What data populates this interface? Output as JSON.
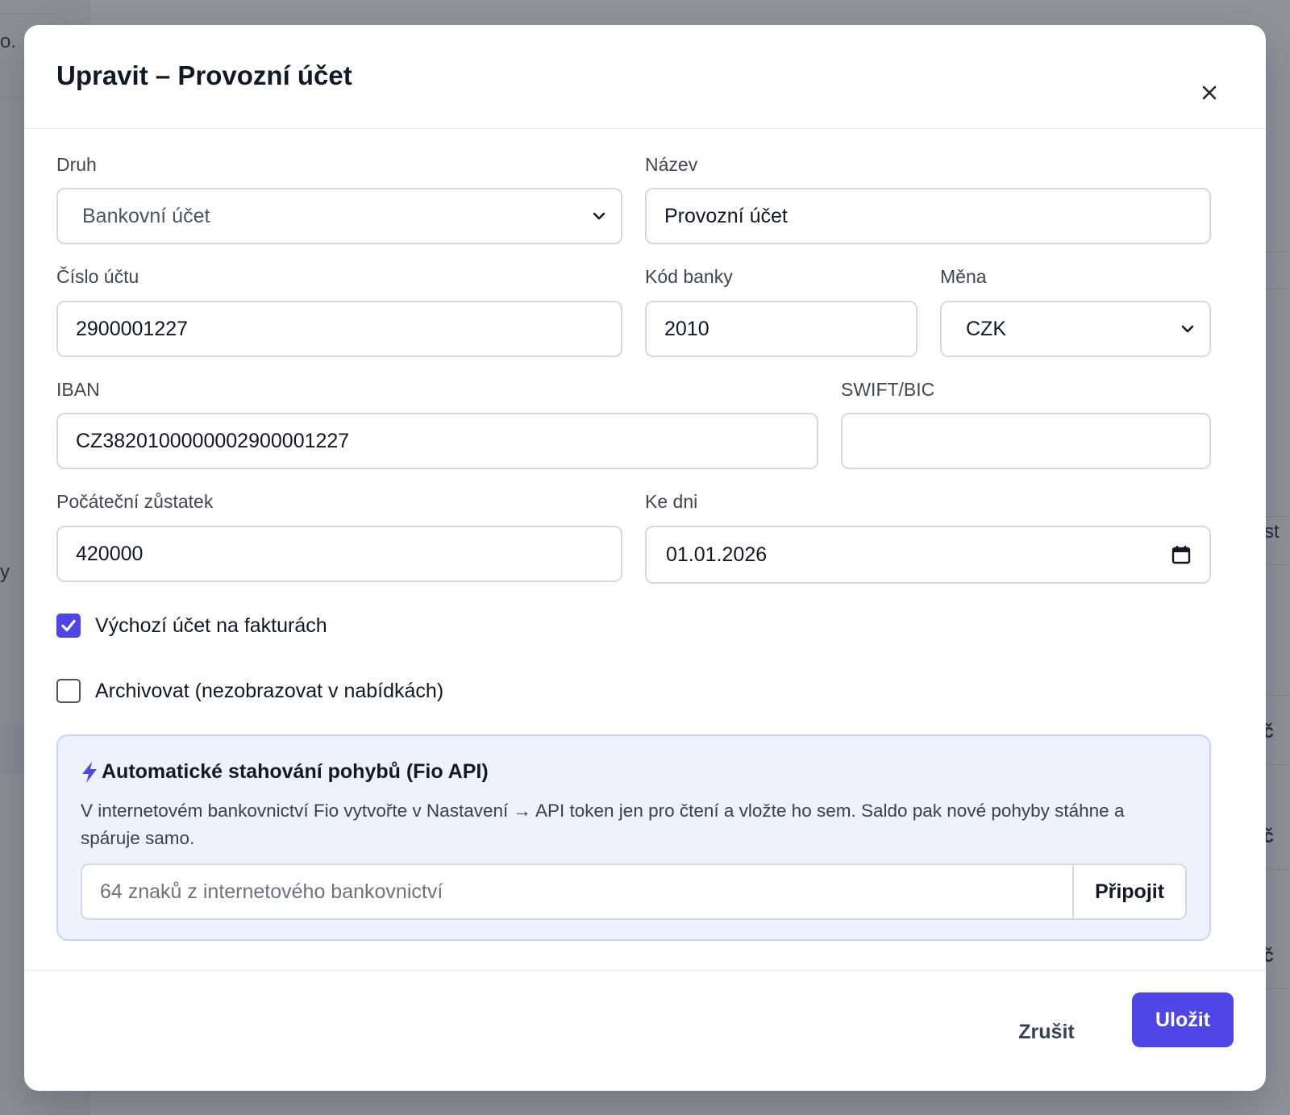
{
  "background": {
    "fragments": [
      "o.",
      "y",
      "tist",
      "úč",
      "úč",
      "úč"
    ]
  },
  "modal": {
    "title": "Upravit – Provozní účet",
    "close_label": "×"
  },
  "form": {
    "druh": {
      "label": "Druh",
      "value": "Bankovní účet"
    },
    "nazev": {
      "label": "Název",
      "value": "Provozní účet"
    },
    "cislo_uctu": {
      "label": "Číslo účtu",
      "value": "2900001227"
    },
    "kod_banky": {
      "label": "Kód banky",
      "value": "2010"
    },
    "mena": {
      "label": "Měna",
      "value": "CZK"
    },
    "iban": {
      "label": "IBAN",
      "value": "CZ3820100000002900001227"
    },
    "swift": {
      "label": "SWIFT/BIC",
      "value": ""
    },
    "pocatecni_zustatek": {
      "label": "Počáteční zůstatek",
      "value": "420000"
    },
    "ke_dni": {
      "label": "Ke dni",
      "value": "01.01.2026"
    },
    "vychozi_ucet": {
      "label": "Výchozí účet na fakturách",
      "checked": true
    },
    "archivovat": {
      "label": "Archivovat (nezobrazovat v nabídkách)",
      "checked": false
    }
  },
  "fio": {
    "title": "Automatické stahování pohybů (Fio API)",
    "description": "V internetovém bankovnictví Fio vytvořte v Nastavení → API token jen pro čtení a vložte ho sem. Saldo pak nové pohyby stáhne a spáruje samo.",
    "token_placeholder": "64 znaků z internetového bankovnictví",
    "connect_label": "Připojit"
  },
  "footer": {
    "cancel_label": "Zrušit",
    "save_label": "Uložit"
  },
  "colors": {
    "accent": "#4f46e5",
    "fio_bg": "#eef2ff",
    "overlay": "#8e929b"
  },
  "icons": [
    "close-icon",
    "chevron-down-icon",
    "calendar-icon",
    "check-icon",
    "lightning-icon"
  ]
}
